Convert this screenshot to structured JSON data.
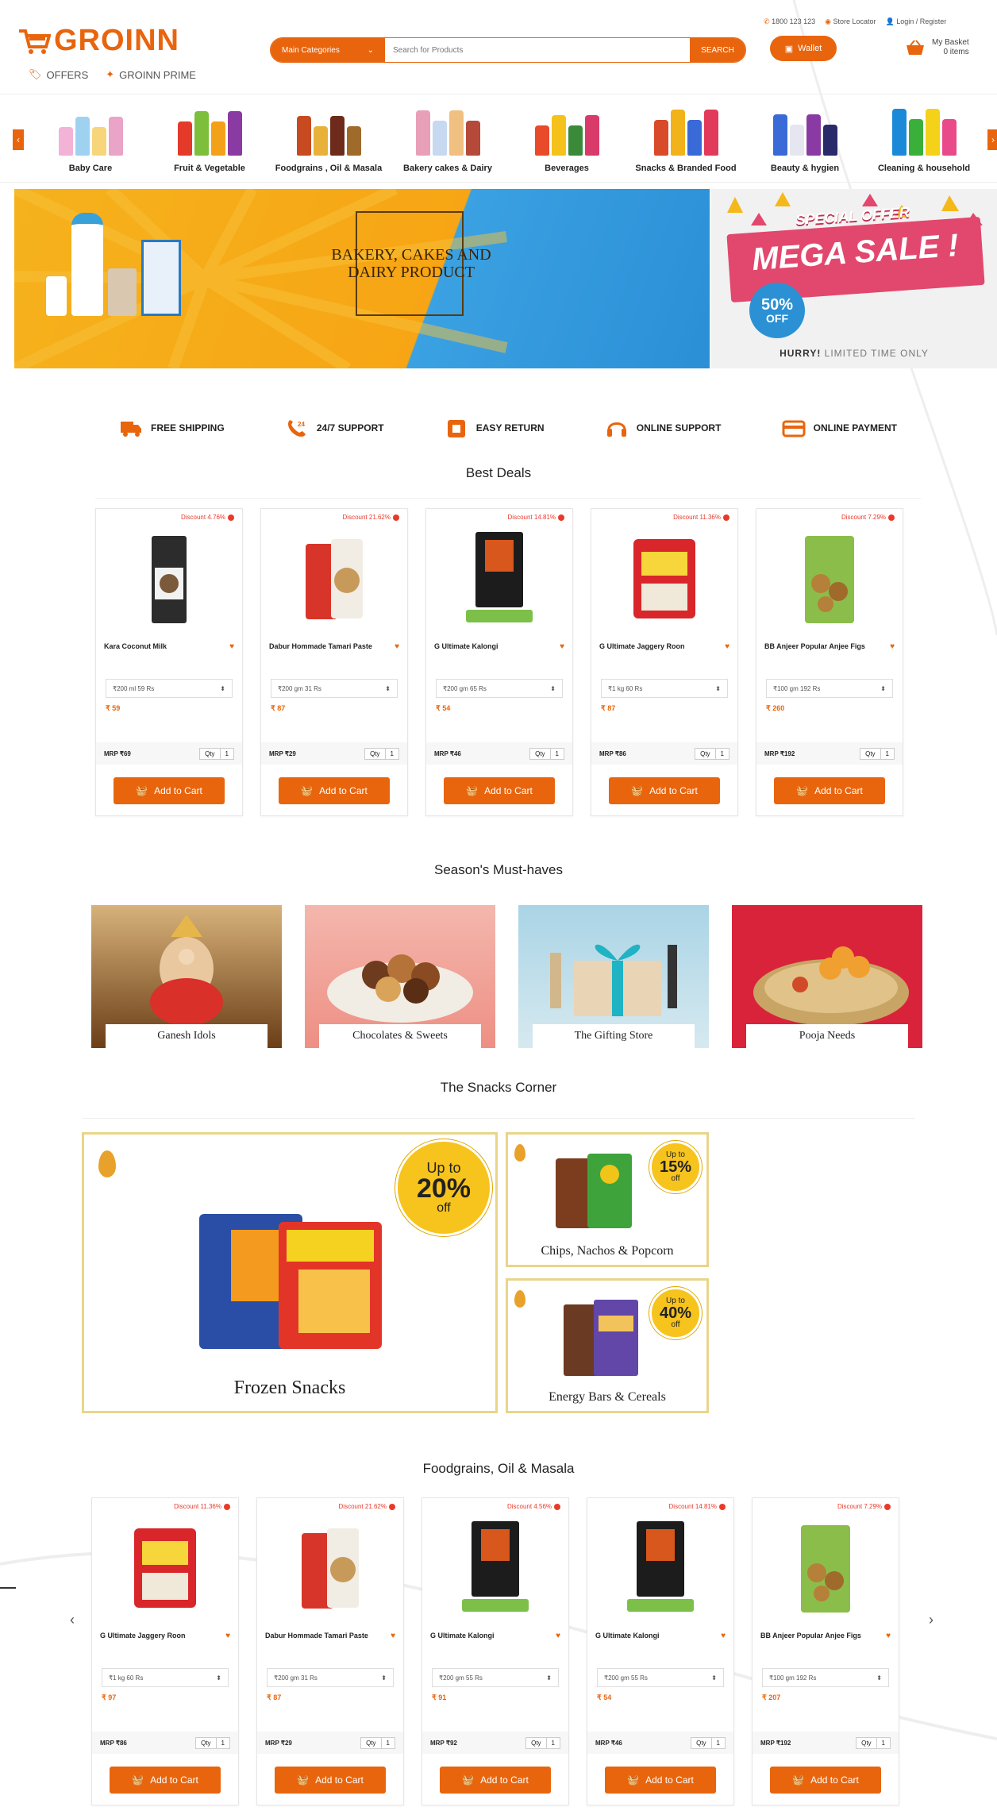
{
  "header": {
    "logo": "GROINN",
    "offers": "OFFERS",
    "prime": "GROINN PRIME",
    "search_category": "Main Categories",
    "search_placeholder": "Search for Products",
    "search_button": "SEARCH",
    "wallet": "Wallet",
    "phone": "1800 123 123",
    "store_locator": "Store Locator",
    "login": "Login / Register",
    "basket_label": "My Basket",
    "basket_items": "0 items"
  },
  "categories": [
    "Baby Care",
    "Fruit & Vegetable",
    "Foodgrains , Oil & Masala",
    "Bakery cakes & Dairy",
    "Beverages",
    "Snacks & Branded Food",
    "Beauty & hygien",
    "Cleaning & household"
  ],
  "banner": {
    "title": "BAKERY, CAKES AND DAIRY PRODUCT",
    "special": "SPECIAL OFFER",
    "mega": "MEGA SALE !",
    "pct": "50%",
    "off": "OFF",
    "hurry": "HURRY!",
    "limited": "LIMITED TIME ONLY"
  },
  "features": [
    "FREE SHIPPING",
    "24/7 SUPPORT",
    "EASY RETURN",
    "ONLINE SUPPORT",
    "ONLINE PAYMENT"
  ],
  "best_deals": {
    "title": "Best Deals",
    "products": [
      {
        "discount": "Discount 4.76%",
        "name": "Kara Coconut Milk",
        "option": "₹200 ml 59 Rs",
        "price": "₹ 59",
        "mrp": "MRP ₹69",
        "qty": "1",
        "img": "coconut"
      },
      {
        "discount": "Discount 21.62%",
        "name": "Dabur Hommade Tamari Paste",
        "option": "₹200 gm 31 Rs",
        "price": "₹ 87",
        "mrp": "MRP ₹29",
        "qty": "1",
        "img": "dabur"
      },
      {
        "discount": "Discount 14.81%",
        "name": "G Ultimate Kalongi",
        "option": "₹200 gm 65 Rs",
        "price": "₹ 54",
        "mrp": "MRP ₹46",
        "qty": "1",
        "img": "kalongi"
      },
      {
        "discount": "Discount 11.36%",
        "name": "G Ultimate Jaggery Roon",
        "option": "₹1 kg 60 Rs",
        "price": "₹ 87",
        "mrp": "MRP ₹86",
        "qty": "1",
        "img": "jaggery"
      },
      {
        "discount": "Discount 7.29%",
        "name": "BB Anjeer Popular Anjee Figs",
        "option": "₹100 gm 192 Rs",
        "price": "₹ 260",
        "mrp": "MRP ₹192",
        "qty": "1",
        "img": "figs"
      }
    ]
  },
  "season": {
    "title": "Season's Must-haves",
    "tiles": [
      "Ganesh Idols",
      "Chocolates & Sweets",
      "The Gifting Store",
      "Pooja Needs"
    ]
  },
  "snacks": {
    "title": "The Snacks Corner",
    "big": {
      "label": "Frozen Snacks",
      "upto": "Up to",
      "pct": "20%",
      "off": "off"
    },
    "small": [
      {
        "label": "Chips, Nachos & Popcorn",
        "upto": "Up to",
        "pct": "15%",
        "off": "off"
      },
      {
        "label": "Energy Bars & Cereals",
        "upto": "Up to",
        "pct": "40%",
        "off": "off"
      }
    ]
  },
  "foodgrains": {
    "title": "Foodgrains, Oil & Masala",
    "products": [
      {
        "discount": "Discount 11.36%",
        "name": "G Ultimate Jaggery Roon",
        "option": "₹1 kg 60 Rs",
        "price": "₹ 97",
        "mrp": "MRP ₹86",
        "qty": "1",
        "img": "jaggery"
      },
      {
        "discount": "Discount 21.62%",
        "name": "Dabur Hommade Tamari Paste",
        "option": "₹200 gm 31 Rs",
        "price": "₹ 87",
        "mrp": "MRP ₹29",
        "qty": "1",
        "img": "dabur"
      },
      {
        "discount": "Discount 4.56%",
        "name": "G Ultimate Kalongi",
        "option": "₹200 gm 55 Rs",
        "price": "₹ 91",
        "mrp": "MRP ₹92",
        "qty": "1",
        "img": "kalongi"
      },
      {
        "discount": "Discount 14.81%",
        "name": "G Ultimate Kalongi",
        "option": "₹200 gm 55 Rs",
        "price": "₹ 54",
        "mrp": "MRP ₹46",
        "qty": "1",
        "img": "kalongi"
      },
      {
        "discount": "Discount 7.29%",
        "name": "BB Anjeer Popular Anjee Figs",
        "option": "₹100 gm 192 Rs",
        "price": "₹ 207",
        "mrp": "MRP ₹192",
        "qty": "1",
        "img": "figs"
      }
    ]
  },
  "add_to_cart": "Add to Cart",
  "qty_label": "Qty",
  "colors": {
    "accent": "#e8650e",
    "discount": "#e83a2a",
    "gold_border": "#e9d58a"
  }
}
